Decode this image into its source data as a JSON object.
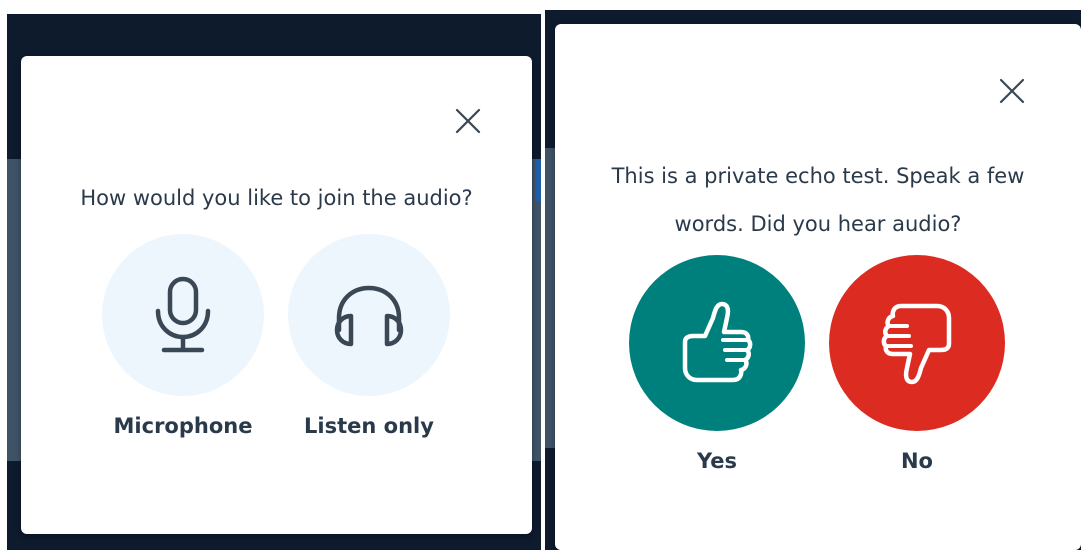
{
  "join_dialog": {
    "prompt": "How would you like to join the audio?",
    "options": [
      {
        "label": "Microphone",
        "icon": "microphone-icon"
      },
      {
        "label": "Listen only",
        "icon": "headphones-icon"
      }
    ]
  },
  "echo_dialog": {
    "prompt_line1": "This is a private echo test. Speak a few",
    "prompt_line2": "words. Did you hear audio?",
    "options": [
      {
        "label": "Yes",
        "icon": "thumbs-up-icon",
        "color": "#00807c"
      },
      {
        "label": "No",
        "icon": "thumbs-down-icon",
        "color": "#dc2b20"
      }
    ]
  },
  "colors": {
    "backdrop": "#0d1b2d",
    "text": "#2a3a4a",
    "option_bg": "#eef6fd",
    "yes": "#00807c",
    "no": "#dc2b20"
  }
}
